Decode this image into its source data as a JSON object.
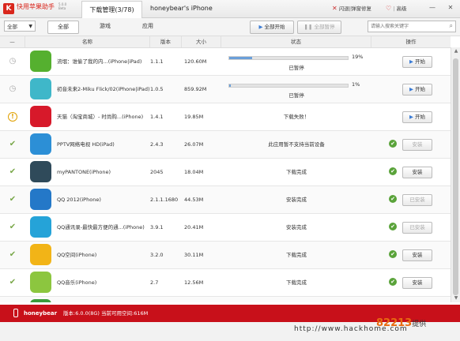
{
  "titlebar": {
    "logo": "K",
    "app_name": "快用苹果助手",
    "app_version_lines": [
      "5.0.0",
      "Beta"
    ],
    "tab_label": "下载管理(3/78)",
    "device_title": "honeybear's iPhone",
    "flash_fix": "闪退|弹窗修复",
    "premium": "高级",
    "minimize": "—",
    "close": "✕"
  },
  "toolbar": {
    "category_select": "全部",
    "filters": [
      "全部",
      "游戏",
      "应用"
    ],
    "start_all": "全部开始",
    "pause_all": "全部暂停",
    "search_placeholder": "请输入搜索关键字"
  },
  "columns": [
    "名称",
    "版本",
    "大小",
    "状态",
    "操作"
  ],
  "rows": [
    {
      "status_icon": "clock",
      "name": "流氓：谁偷了我的内...(iPhone|iPad)",
      "version": "1.1.1",
      "size": "120.60M",
      "state": "progress",
      "progress": 19,
      "progress_label": "19%",
      "status_text": "已暂停",
      "action": "开始",
      "action_type": "start",
      "icon_color": "#55b02f"
    },
    {
      "status_icon": "clock",
      "name": "初音未来2-Miku Flick/02(iPhone|iPad)",
      "version": "1.0.5",
      "size": "859.92M",
      "state": "progress",
      "progress": 1,
      "progress_label": "1%",
      "status_text": "已暂停",
      "action": "开始",
      "action_type": "start",
      "icon_color": "#3fb7c9"
    },
    {
      "status_icon": "warning",
      "name": "天猫（淘宝商城）- 时尚购...(iPhone)",
      "version": "1.4.1",
      "size": "19.85M",
      "state": "text",
      "status_text": "下载失败！",
      "action": "开始",
      "action_type": "start",
      "icon_color": "#d7192a"
    },
    {
      "status_icon": "check",
      "name": "PPTV网络电视 HD(iPad)",
      "version": "2.4.3",
      "size": "26.07M",
      "state": "text",
      "status_text": "此应用暂不支持当前设备",
      "action": "安装",
      "action_type": "install-disabled",
      "icon_color": "#2c8fd6"
    },
    {
      "status_icon": "check",
      "name": "myPANTONE(iPhone)",
      "version": "2045",
      "size": "18.04M",
      "state": "text",
      "status_text": "下载完成",
      "action": "安装",
      "action_type": "install",
      "icon_color": "#2f4a5a"
    },
    {
      "status_icon": "check",
      "name": "QQ 2012(iPhone)",
      "version": "2.1.1.1680",
      "size": "44.53M",
      "state": "text",
      "status_text": "安装完成",
      "action": "已安装",
      "action_type": "installed",
      "icon_color": "#2478c8"
    },
    {
      "status_icon": "check",
      "name": "QQ通讯录-最快最方便的通...(iPhone)",
      "version": "3.9.1",
      "size": "20.41M",
      "state": "text",
      "status_text": "安装完成",
      "action": "已安装",
      "action_type": "installed",
      "icon_color": "#25a3d8"
    },
    {
      "status_icon": "check",
      "name": "QQ空间(iPhone)",
      "version": "3.2.0",
      "size": "30.11M",
      "state": "text",
      "status_text": "下载完成",
      "action": "安装",
      "action_type": "install",
      "icon_color": "#f2b417"
    },
    {
      "status_icon": "check",
      "name": "QQ音乐(iPhone)",
      "version": "2.7",
      "size": "12.56M",
      "state": "text",
      "status_text": "下载完成",
      "action": "安装",
      "action_type": "install",
      "icon_color": "#8cc63f"
    },
    {
      "status_icon": "check",
      "name": "",
      "version": "",
      "size": "",
      "state": "text",
      "status_text": "",
      "action": "",
      "action_type": "none",
      "icon_color": "#3a9b3a"
    }
  ],
  "footer": {
    "device": "honeybear",
    "info": "版本:6.0.0(8G) 当前可用空间:616M"
  },
  "watermark": {
    "url": "http://www.hackhome.com",
    "brand": "82213",
    "suffix": "提供"
  }
}
